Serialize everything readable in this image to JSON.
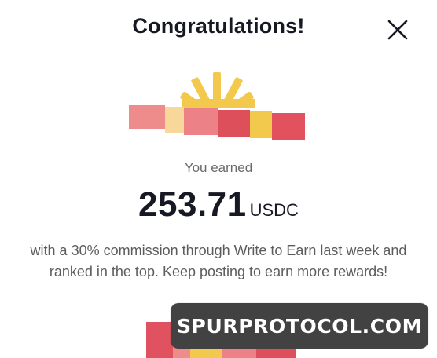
{
  "dialog": {
    "title": "Congratulations!",
    "close_icon": "close-icon",
    "gift_icon": "gift-box-icon"
  },
  "reward": {
    "earned_label": "You earned",
    "amount": "253.71",
    "currency": "USDC",
    "message": "with a 30% commission through Write to Earn last week and ranked in the top. Keep posting to earn more rewards!"
  },
  "watermark": {
    "text": "SPURPROTOCOL.COM"
  },
  "colors": {
    "title_text": "#161823",
    "secondary_text": "#5c5c5c",
    "gift_bow": "#f2c94c",
    "gift_ribbon_red": "#e05260",
    "gift_pink": "#ee8b8b",
    "watermark_bg": "#424242"
  }
}
